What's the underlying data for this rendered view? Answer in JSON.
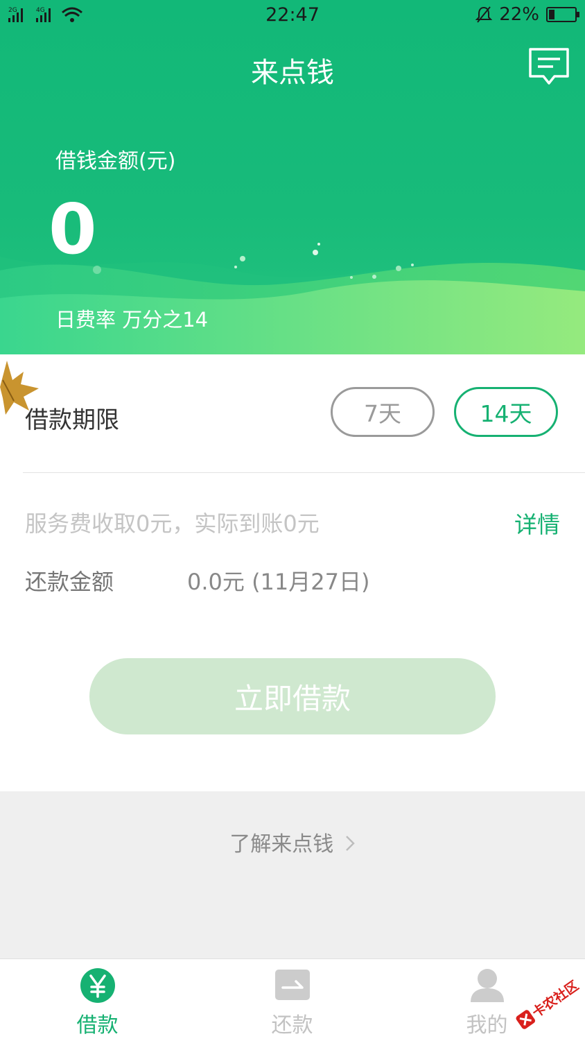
{
  "status_bar": {
    "time": "22:47",
    "battery": "22%",
    "battery_level": 0.22,
    "net1": "2G",
    "net2": "4G"
  },
  "header": {
    "title": "来点钱",
    "amount_label": "借钱金额(元)",
    "amount": "0",
    "rate": "日费率 万分之14"
  },
  "term": {
    "label": "借款期限",
    "options": [
      "7天",
      "14天"
    ],
    "selected": "14天"
  },
  "fee": {
    "text": "服务费收取0元，实际到账0元",
    "detail_link": "详情"
  },
  "repayment": {
    "label": "还款金额",
    "value": "0.0元 (11月27日)"
  },
  "loan_button": "立即借款",
  "learn_more": "了解来点钱",
  "tabs": [
    {
      "label": "借款",
      "icon": "yen-icon",
      "active": true
    },
    {
      "label": "还款",
      "icon": "repay-icon",
      "active": false
    },
    {
      "label": "我的",
      "icon": "user-icon",
      "active": false
    }
  ],
  "colors": {
    "brand_green": "#16b172",
    "header_green": "#12b878",
    "button_disabled": "#cfe8cf"
  },
  "watermark": "卡农社区"
}
